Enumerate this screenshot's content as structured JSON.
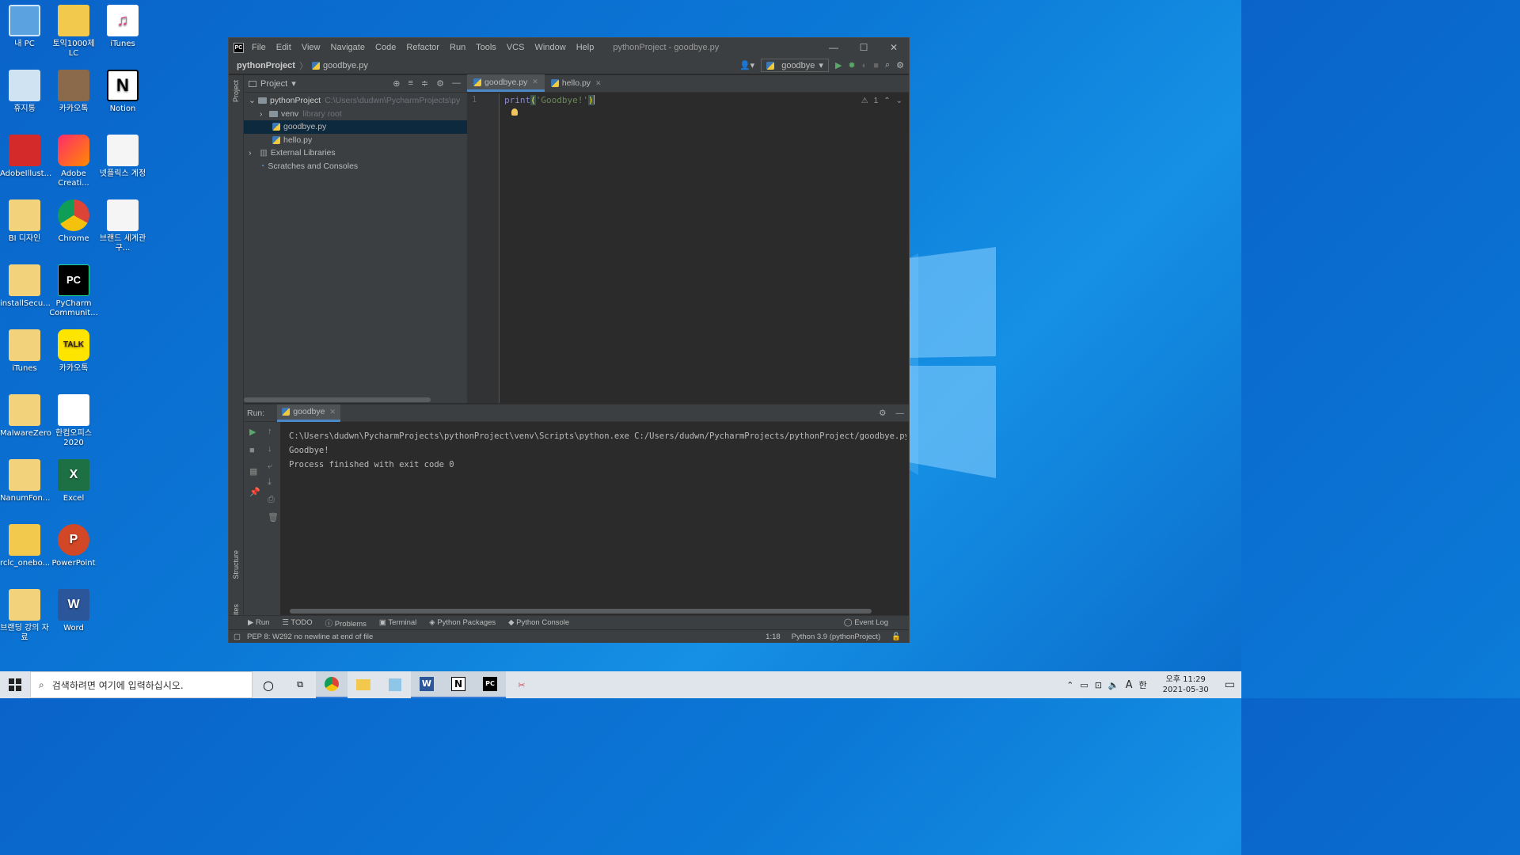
{
  "desktop": {
    "icons": [
      {
        "label": "내 PC"
      },
      {
        "label": "토익1000제 LC"
      },
      {
        "label": "iTunes"
      },
      {
        "label": "휴지통"
      },
      {
        "label": "카카오톡"
      },
      {
        "label": "Notion"
      },
      {
        "label": "AdobeIllust..."
      },
      {
        "label": "Adobe Creati..."
      },
      {
        "label": "넷플릭스 계정"
      },
      {
        "label": "BI 디자인"
      },
      {
        "label": "Chrome"
      },
      {
        "label": "브랜드 세계관 구..."
      },
      {
        "label": "installSecu..."
      },
      {
        "label": "PyCharm Communit..."
      },
      {
        "label": "iTunes"
      },
      {
        "label": "카카오톡"
      },
      {
        "label": "MalwareZero"
      },
      {
        "label": "한컴오피스 2020"
      },
      {
        "label": "NanumFon..."
      },
      {
        "label": "Excel"
      },
      {
        "label": "rclc_onebo..."
      },
      {
        "label": "PowerPoint"
      },
      {
        "label": "브랜딩 강의 자료"
      },
      {
        "label": "Word"
      }
    ]
  },
  "window": {
    "logo": "PC",
    "menu": [
      "File",
      "Edit",
      "View",
      "Navigate",
      "Code",
      "Refactor",
      "Run",
      "Tools",
      "VCS",
      "Window",
      "Help"
    ],
    "title": "pythonProject - goodbye.py",
    "controls": {
      "minimize": "—",
      "maximize": "☐",
      "close": "✕"
    }
  },
  "navbar": {
    "project": "pythonProject",
    "file": "goodbye.py",
    "run_config": "goodbye"
  },
  "project_panel": {
    "title": "Project",
    "side_label": "Project",
    "tree": {
      "root": "pythonProject",
      "root_path": "C:\\Users\\dudwn\\PycharmProjects\\py",
      "venv": "venv",
      "venv_hint": "library root",
      "files": [
        "goodbye.py",
        "hello.py"
      ],
      "external": "External Libraries",
      "scratches": "Scratches and Consoles"
    }
  },
  "editor": {
    "tabs": [
      "goodbye.py",
      "hello.py"
    ],
    "line_number": "1",
    "code": {
      "fn": "print",
      "open": "(",
      "str": "'Goodbye!'",
      "close": ")"
    },
    "warnings": "1"
  },
  "run_panel": {
    "label": "Run:",
    "tab": "goodbye",
    "output": [
      "C:\\Users\\dudwn\\PycharmProjects\\pythonProject\\venv\\Scripts\\python.exe C:/Users/dudwn/PycharmProjects/pythonProject/goodbye.py",
      "Goodbye!",
      "",
      "Process finished with exit code 0"
    ]
  },
  "side_labels": {
    "structure": "Structure",
    "favorites": "Favorites"
  },
  "bottom_tabs": [
    "Run",
    "TODO",
    "Problems",
    "Terminal",
    "Python Packages",
    "Python Console"
  ],
  "event_log": "Event Log",
  "status": {
    "message": "PEP 8: W292 no newline at end of file",
    "position": "1:18",
    "interpreter": "Python 3.9 (pythonProject)"
  },
  "taskbar": {
    "search_placeholder": "검색하려면 여기에 입력하십시오.",
    "time": "오후 11:29",
    "date": "2021-05-30",
    "ime_a": "A",
    "ime_kor": "한"
  }
}
